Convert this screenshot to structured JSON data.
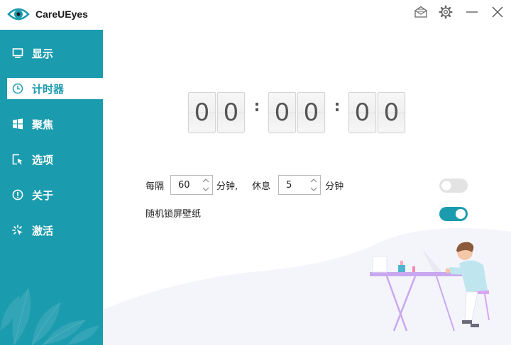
{
  "app": {
    "title": "CareUEyes",
    "logo_icon": "eye-icon",
    "brand_color": "#1b9bae"
  },
  "titlebar": {
    "buttons": [
      {
        "name": "mail-icon"
      },
      {
        "name": "gear-icon"
      },
      {
        "name": "minimize-icon"
      },
      {
        "name": "close-icon"
      }
    ]
  },
  "sidebar": {
    "items": [
      {
        "label": "显示",
        "icon": "monitor-icon",
        "active": false
      },
      {
        "label": "计时器",
        "icon": "clock-icon",
        "active": true
      },
      {
        "label": "聚焦",
        "icon": "windows-icon",
        "active": false
      },
      {
        "label": "选项",
        "icon": "cursor-icon",
        "active": false
      },
      {
        "label": "关于",
        "icon": "info-icon",
        "active": false
      },
      {
        "label": "激活",
        "icon": "sparkle-icon",
        "active": false
      }
    ]
  },
  "timer": {
    "digits": [
      "0",
      "0",
      "0",
      "0",
      "0",
      "0"
    ],
    "separator": ":"
  },
  "settings": {
    "interval_label": "每隔",
    "interval_value": "60",
    "interval_unit": "分钟,",
    "rest_label": "休息",
    "rest_value": "5",
    "rest_unit": "分钟",
    "rest_toggle_on": false,
    "wallpaper_label": "随机锁屏壁纸",
    "wallpaper_toggle_on": true
  }
}
